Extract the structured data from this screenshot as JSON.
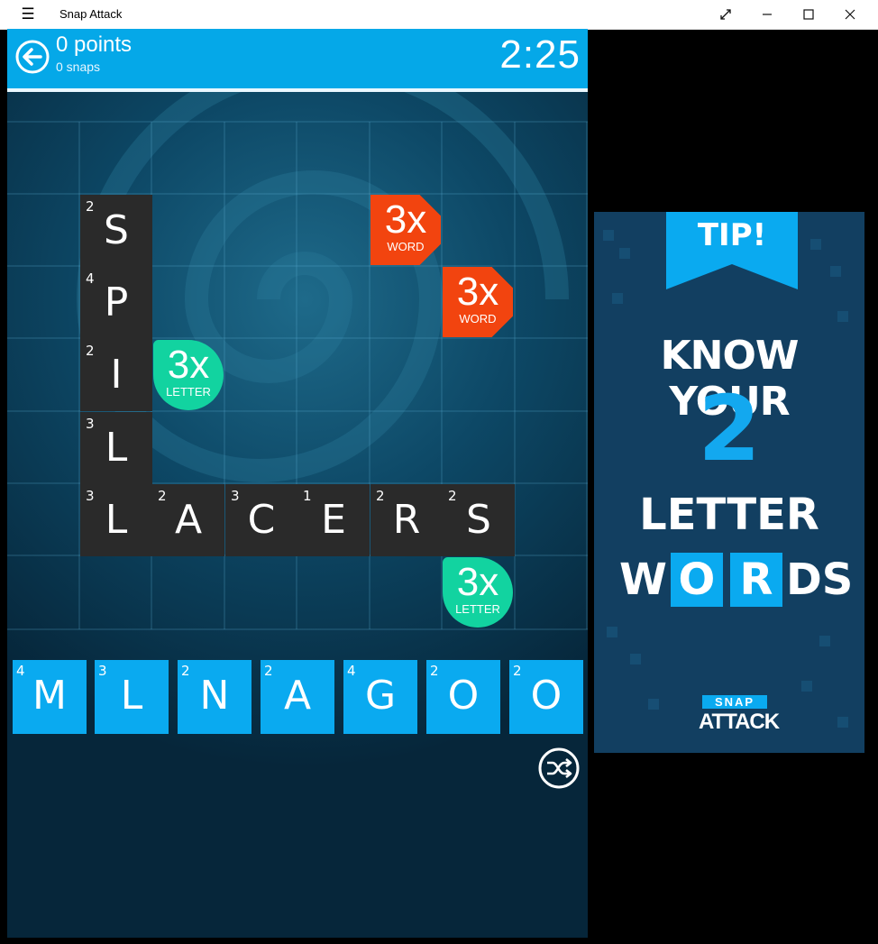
{
  "window": {
    "title": "Snap Attack"
  },
  "header": {
    "points": "0 points",
    "snaps": "0 snaps",
    "timer": "2:25"
  },
  "board": {
    "tiles": [
      {
        "letter": "S",
        "points": "2"
      },
      {
        "letter": "P",
        "points": "4"
      },
      {
        "letter": "I",
        "points": "2"
      },
      {
        "letter": "L",
        "points": "3"
      },
      {
        "letter": "L",
        "points": "3"
      },
      {
        "letter": "A",
        "points": "2"
      },
      {
        "letter": "C",
        "points": "3"
      },
      {
        "letter": "E",
        "points": "1"
      },
      {
        "letter": "R",
        "points": "2"
      },
      {
        "letter": "S",
        "points": "2"
      }
    ],
    "bonuses": [
      {
        "mult": "3x",
        "kind": "WORD"
      },
      {
        "mult": "3x",
        "kind": "WORD"
      },
      {
        "mult": "3x",
        "kind": "LETTER"
      },
      {
        "mult": "3x",
        "kind": "LETTER"
      }
    ]
  },
  "rack": [
    {
      "letter": "M",
      "points": "4"
    },
    {
      "letter": "L",
      "points": "3"
    },
    {
      "letter": "N",
      "points": "2"
    },
    {
      "letter": "A",
      "points": "2"
    },
    {
      "letter": "G",
      "points": "4"
    },
    {
      "letter": "O",
      "points": "2"
    },
    {
      "letter": "O",
      "points": "2"
    }
  ],
  "ad": {
    "tip": "TIP!",
    "line1": "KNOW YOUR",
    "big": "2",
    "line3": "LETTER",
    "w": "W",
    "o": "O",
    "r": "R",
    "ds": "DS",
    "logo_top": "SNAP",
    "logo_bottom": "ATTACK"
  },
  "colors": {
    "header": "#05a8e8",
    "board_bg": "#0b3a55",
    "tile": "#2a2a2a",
    "rack_tile": "#0aaaf0",
    "word_bonus": "#f2440f",
    "letter_bonus": "#12d3a0"
  },
  "icons": {
    "menu": "hamburger-icon",
    "back": "back-arrow-icon",
    "shuffle": "shuffle-icon"
  }
}
